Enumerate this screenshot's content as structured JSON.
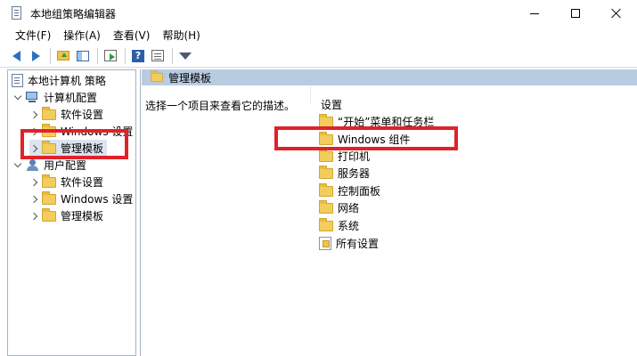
{
  "window": {
    "title": "本地组策略编辑器"
  },
  "menu": [
    "文件(F)",
    "操作(A)",
    "查看(V)",
    "帮助(H)"
  ],
  "toolbar": {
    "icons": [
      "back-icon",
      "forward-icon",
      "up-folder-icon",
      "show-hide-tree-icon",
      "export-icon",
      "help-icon",
      "properties-icon",
      "filter-icon"
    ]
  },
  "tree": {
    "root": "本地计算机 策略",
    "computer_config": "计算机配置",
    "computer_children": [
      "软件设置",
      "Windows 设置",
      "管理模板"
    ],
    "user_config": "用户配置",
    "user_children": [
      "软件设置",
      "Windows 设置",
      "管理模板"
    ]
  },
  "details": {
    "header": "管理模板",
    "description": "选择一个项目来查看它的描述。",
    "column_label": "设置",
    "items": [
      "“开始”菜单和任务栏",
      "Windows 组件",
      "打印机",
      "服务器",
      "控制面板",
      "网络",
      "系统",
      "所有设置"
    ]
  },
  "colors": {
    "highlight": "#e0222a",
    "header_bg": "#b9cbe1",
    "folder": "#f3cd5b"
  }
}
